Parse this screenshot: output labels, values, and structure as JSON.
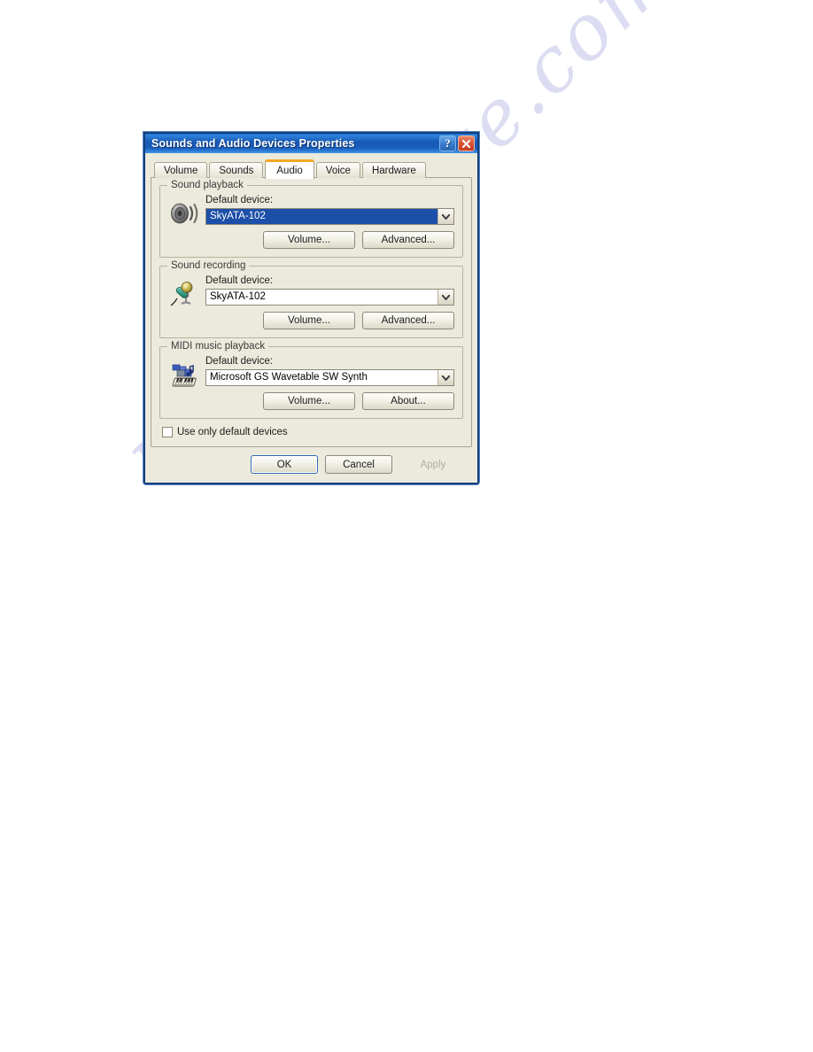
{
  "watermark": {
    "text": "manualshive.com",
    "color": "#dcdcf2"
  },
  "window": {
    "title": "Sounds and Audio Devices Properties",
    "help_button": "?",
    "close_button": "✕",
    "help_icon": "question-mark-icon",
    "close_icon": "close-x-icon",
    "titlebar_color": "#1859b5",
    "close_color": "#d9563a"
  },
  "tabs": [
    {
      "label": "Volume",
      "active": false
    },
    {
      "label": "Sounds",
      "active": false
    },
    {
      "label": "Audio",
      "active": true
    },
    {
      "label": "Voice",
      "active": false
    },
    {
      "label": "Hardware",
      "active": false
    }
  ],
  "active_tab_accent": "#f5a623",
  "groups": {
    "playback": {
      "legend": "Sound playback",
      "icon": "speaker-icon",
      "field_label": "Default device:",
      "device": "SkyATA-102",
      "device_selected": true,
      "buttons": [
        {
          "label": "Volume..."
        },
        {
          "label": "Advanced..."
        }
      ]
    },
    "recording": {
      "legend": "Sound recording",
      "icon": "microphone-icon",
      "field_label": "Default device:",
      "device": "SkyATA-102",
      "device_selected": false,
      "buttons": [
        {
          "label": "Volume..."
        },
        {
          "label": "Advanced..."
        }
      ]
    },
    "midi": {
      "legend": "MIDI music playback",
      "icon": "midi-keyboard-icon",
      "field_label": "Default device:",
      "device": "Microsoft GS Wavetable SW Synth",
      "device_selected": false,
      "buttons": [
        {
          "label": "Volume..."
        },
        {
          "label": "About..."
        }
      ]
    }
  },
  "use_only_default": {
    "label": "Use only default devices",
    "checked": false
  },
  "footer": {
    "ok": "OK",
    "cancel": "Cancel",
    "apply": "Apply",
    "apply_disabled": true
  }
}
